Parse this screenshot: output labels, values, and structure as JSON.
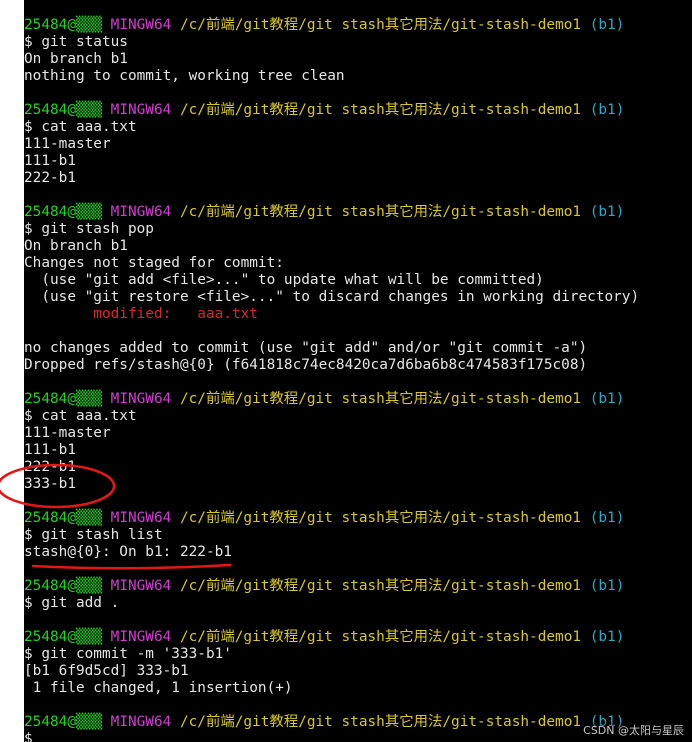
{
  "prompt": {
    "user_host": "25484@▒▒▒",
    "system": "MINGW64",
    "path": "/c/前端/git教程/git stash其它用法/git-stash-demo1",
    "branch": "(b1)"
  },
  "blocks": [
    {
      "cmd": "$ git status",
      "output": [
        {
          "text": "On branch b1",
          "color": "white"
        },
        {
          "text": "nothing to commit, working tree clean",
          "color": "white"
        }
      ]
    },
    {
      "cmd": "$ cat aaa.txt",
      "output": [
        {
          "text": "111-master",
          "color": "white"
        },
        {
          "text": "111-b1",
          "color": "white"
        },
        {
          "text": "222-b1",
          "color": "white"
        }
      ]
    },
    {
      "cmd": "$ git stash pop",
      "output": [
        {
          "text": "On branch b1",
          "color": "white"
        },
        {
          "text": "Changes not staged for commit:",
          "color": "white"
        },
        {
          "text": "  (use \"git add <file>...\" to update what will be committed)",
          "color": "white"
        },
        {
          "text": "  (use \"git restore <file>...\" to discard changes in working directory)",
          "color": "white"
        },
        {
          "text": "        modified:   aaa.txt",
          "color": "red"
        },
        {
          "text": "",
          "color": "white"
        },
        {
          "text": "no changes added to commit (use \"git add\" and/or \"git commit -a\")",
          "color": "white"
        },
        {
          "text": "Dropped refs/stash@{0} (f641818c74ec8420ca7d6ba6b8c474583f175c08)",
          "color": "white"
        }
      ]
    },
    {
      "cmd": "$ cat aaa.txt",
      "output": [
        {
          "text": "111-master",
          "color": "white"
        },
        {
          "text": "111-b1",
          "color": "white"
        },
        {
          "text": "222-b1",
          "color": "white"
        },
        {
          "text": "333-b1",
          "color": "white"
        }
      ]
    },
    {
      "cmd": "$ git stash list",
      "output": [
        {
          "text": "stash@{0}: On b1: 222-b1",
          "color": "white"
        }
      ]
    },
    {
      "cmd": "$ git add .",
      "output": []
    },
    {
      "cmd": "$ git commit -m '333-b1'",
      "output": [
        {
          "text": "[b1 6f9d5cd] 333-b1",
          "color": "white"
        },
        {
          "text": " 1 file changed, 1 insertion(+)",
          "color": "white"
        }
      ]
    },
    {
      "cmd": "$ ",
      "output": []
    }
  ],
  "watermark": "CSDN @太阳与星辰",
  "colors": {
    "background": "#000000",
    "user_host": "#1fd41f",
    "system": "#d23cd2",
    "path": "#d7c728",
    "branch": "#2aa9c9",
    "modified": "#d32b2b",
    "annotation": "#e01818"
  }
}
